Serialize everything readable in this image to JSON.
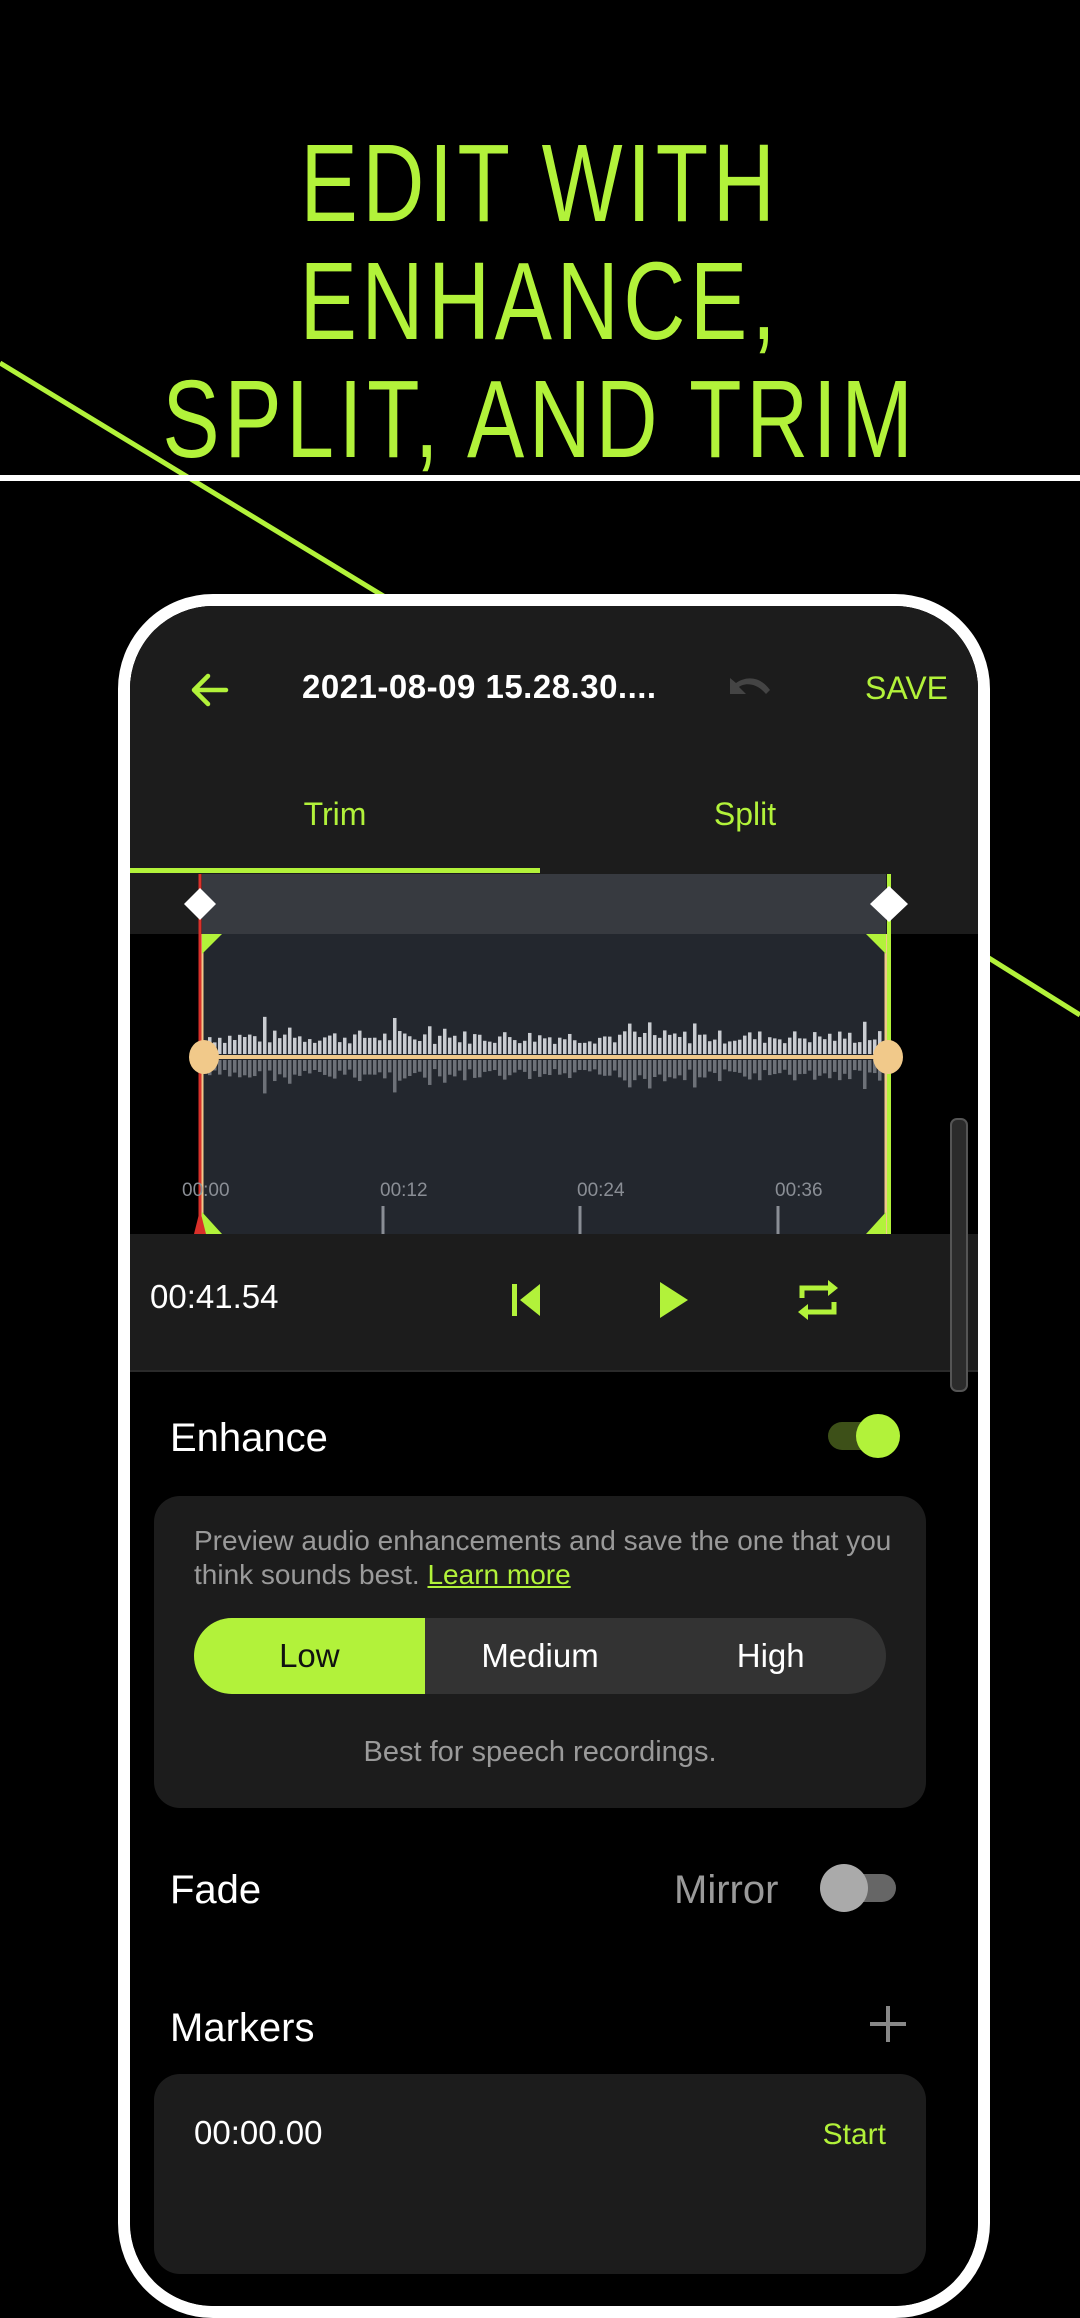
{
  "headline": {
    "line1": "EDIT WITH ENHANCE,",
    "line2": "SPLIT, AND TRIM"
  },
  "colors": {
    "accent": "#b2f23a",
    "background": "#000000",
    "surface": "#1c1c1c",
    "handle": "#f1c98a",
    "playhead": "#d9302a"
  },
  "app": {
    "back_icon": "arrow-left-icon",
    "title": "2021-08-09 15.28.30....",
    "undo_icon": "undo-icon",
    "save_label": "SAVE",
    "tabs": [
      {
        "label": "Trim",
        "active": true
      },
      {
        "label": "Split",
        "active": false
      }
    ]
  },
  "timeline": {
    "tick_labels": [
      "00:00",
      "00:12",
      "00:24",
      "00:36"
    ],
    "selection_start": "00:00.00",
    "selection_end_fraction": 1.0
  },
  "player": {
    "time": "00:41.54",
    "skip_back_icon": "skip-previous-icon",
    "play_icon": "play-icon",
    "repeat_icon": "repeat-icon"
  },
  "enhance": {
    "label": "Enhance",
    "enabled": true,
    "description": "Preview audio enhancements and save the one that you think sounds best.",
    "learn_more": "Learn more",
    "levels": [
      "Low",
      "Medium",
      "High"
    ],
    "selected_level": "Low",
    "level_description": "Best for speech recordings."
  },
  "fade": {
    "label": "Fade",
    "mirror_label": "Mirror",
    "mirror_enabled": false
  },
  "markers": {
    "label": "Markers",
    "add_icon": "plus-icon",
    "items": [
      {
        "time": "00:00.00",
        "name": "Start"
      }
    ]
  }
}
